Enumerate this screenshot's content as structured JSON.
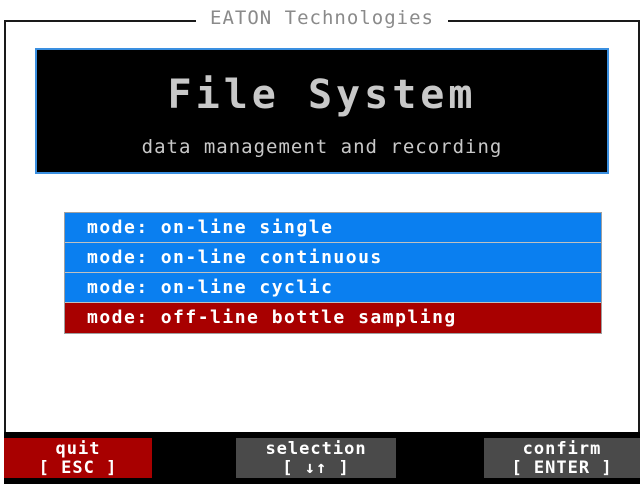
{
  "header": {
    "brand": "EATON Technologies"
  },
  "banner": {
    "title": "File System",
    "subtitle": "data management and recording"
  },
  "menu": {
    "prefix": "mode:",
    "items": [
      {
        "value": "on-line single",
        "selected": false
      },
      {
        "value": "on-line continuous",
        "selected": false
      },
      {
        "value": "on-line cyclic",
        "selected": false
      },
      {
        "value": "off-line bottle sampling",
        "selected": true
      }
    ]
  },
  "keybar": {
    "quit": {
      "label": "quit",
      "hint": "[ ESC ]"
    },
    "selection": {
      "label": "selection",
      "hint": "[ ↓↑ ]"
    },
    "confirm": {
      "label": "confirm",
      "hint": "[ ENTER ]"
    }
  },
  "colors": {
    "item_normal": "#0a7ff0",
    "item_selected": "#a80000",
    "banner_border": "#3a8fe0"
  }
}
